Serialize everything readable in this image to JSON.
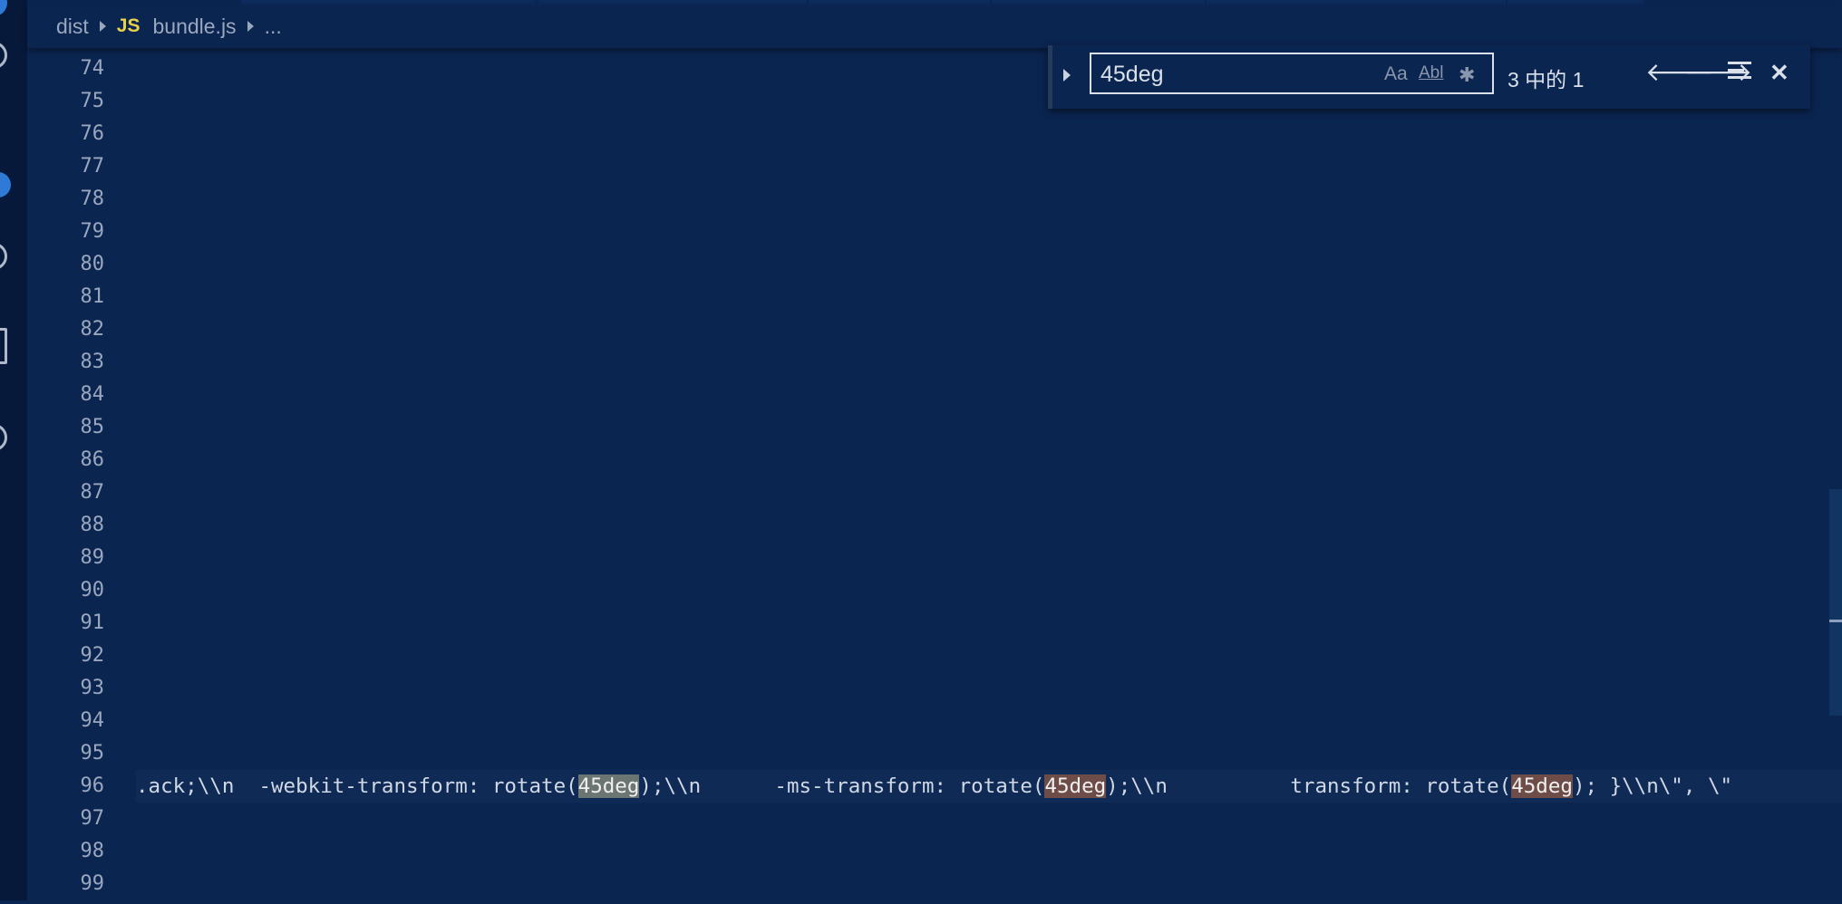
{
  "breadcrumb": {
    "folder": "dist",
    "file_type_badge": "JS",
    "file": "bundle.js",
    "more": "..."
  },
  "gutter": {
    "line_numbers": [
      "74",
      "75",
      "76",
      "77",
      "78",
      "79",
      "80",
      "81",
      "82",
      "83",
      "84",
      "85",
      "86",
      "87",
      "88",
      "89",
      "90",
      "91",
      "92",
      "93",
      "94",
      "95",
      "96",
      "97",
      "98",
      "99"
    ]
  },
  "code": {
    "line_96": {
      "seg1": ".ack;\\\\n  -webkit-transform: rotate(",
      "match1": "45deg",
      "seg2": ");\\\\n      -ms-transform: rotate(",
      "match2": "45deg",
      "seg3": ");\\\\n          transform: rotate(",
      "match3": "45deg",
      "seg4": "); }\\\\n\\\", \\\""
    }
  },
  "find_widget": {
    "query": "45deg",
    "match_case_label": "Aa",
    "whole_word_label": "Abl",
    "regex_label": "✱",
    "result_count": "3 中的 1",
    "prev_icon": "arrow-left",
    "next_icon": "arrow-right",
    "close_icon": "close"
  },
  "colors": {
    "editor_bg": "#0b2551",
    "current_match": "#6b7572",
    "other_match": "#6e4d48",
    "js_badge": "#e9d24a"
  }
}
